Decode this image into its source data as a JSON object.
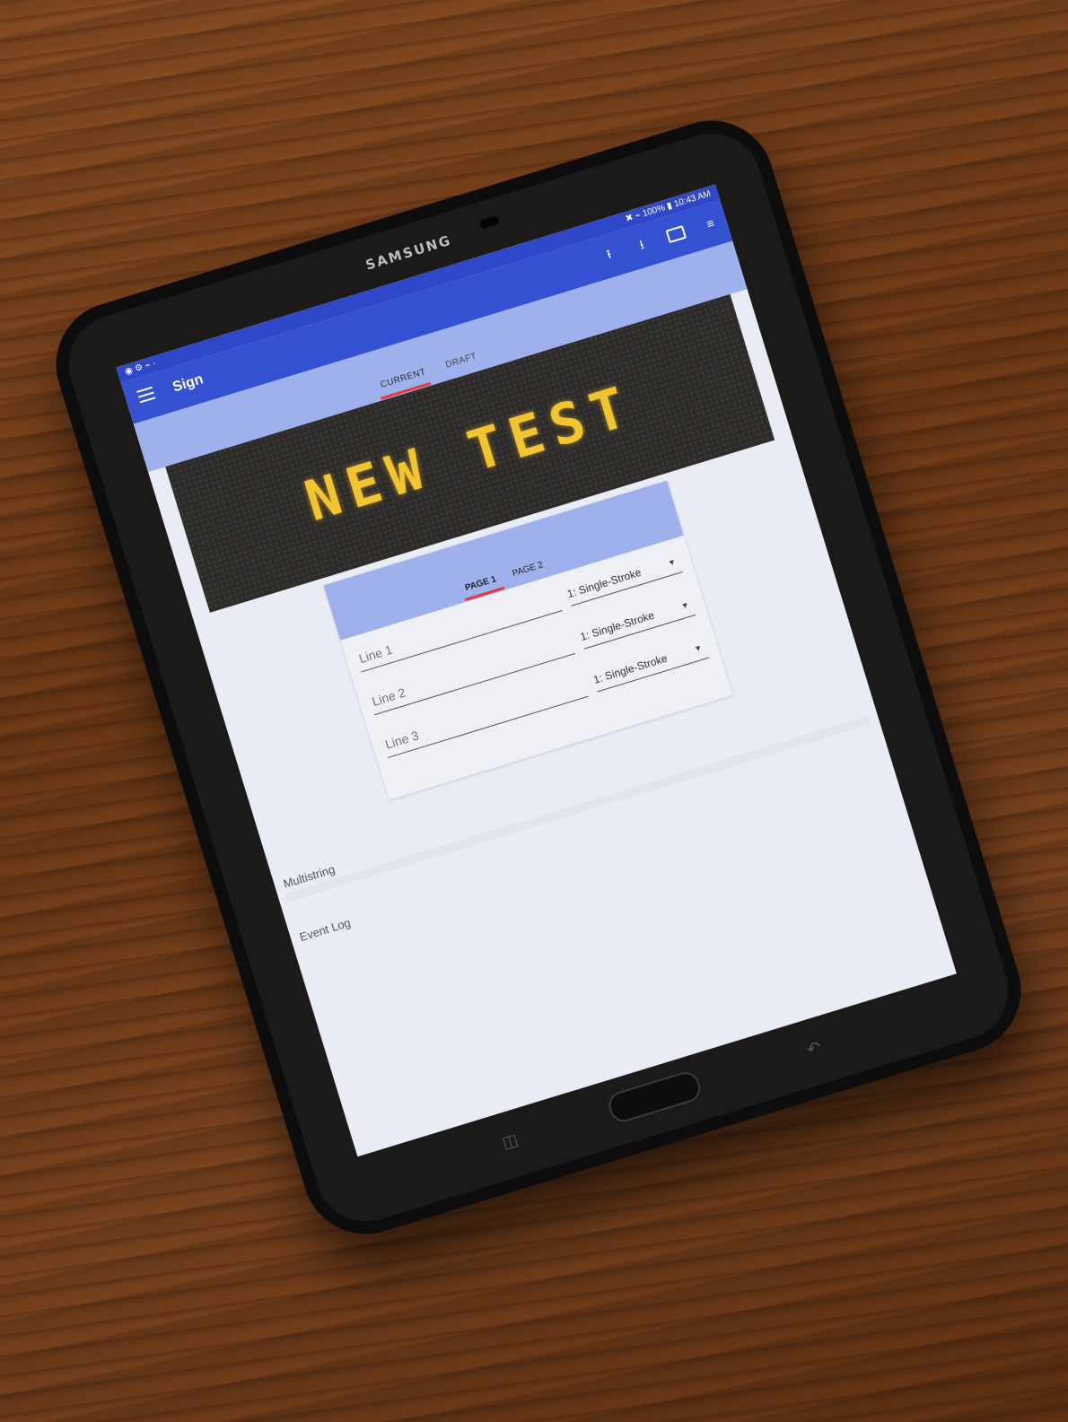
{
  "device": {
    "brand": "SAMSUNG"
  },
  "statusbar": {
    "left": "◉ ⚙ ⌁ ·",
    "right": "✖ ⌁ 100% ▮ 10:43 AM"
  },
  "appbar": {
    "title": "Sign",
    "actions": [
      "upload-icon",
      "download-icon",
      "tablet-icon",
      "more-icon"
    ]
  },
  "tabs": [
    "CURRENT",
    "DRAFT"
  ],
  "sign": {
    "message": "NEW TEST",
    "led_color": "#f2c530"
  },
  "editor": {
    "pages": [
      "PAGE 1",
      "PAGE 2"
    ],
    "lines": [
      {
        "placeholder": "Line 1",
        "font": "1: Single-Stroke"
      },
      {
        "placeholder": "Line 2",
        "font": "1: Single-Stroke"
      },
      {
        "placeholder": "Line 3",
        "font": "1: Single-Stroke"
      }
    ]
  },
  "sections": {
    "multistring": "Multistring",
    "event_log": "Event Log"
  },
  "colors": {
    "appbar": "#3451d1",
    "tab_strip": "#9fb1ec",
    "indicator": "#e53935"
  }
}
